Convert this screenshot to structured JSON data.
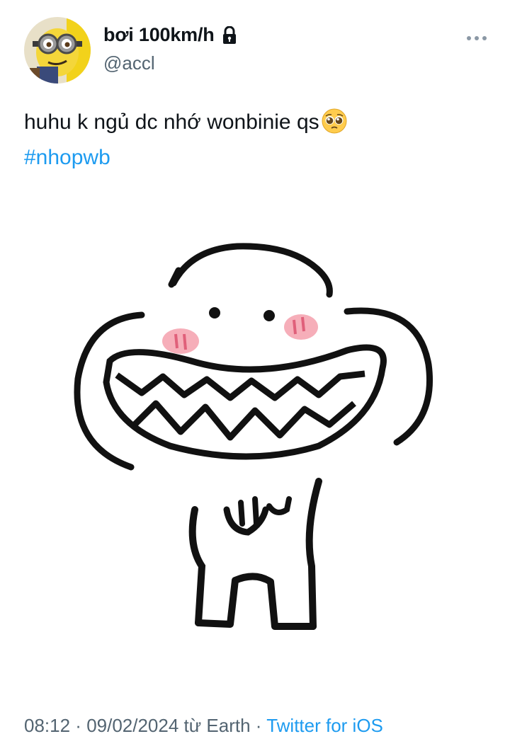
{
  "author": {
    "display_name": "bơi 100km/h",
    "handle": "@accl",
    "avatar_icon": "minion-avatar",
    "locked_icon": "lock-icon"
  },
  "tweet": {
    "text": "huhu k ngủ dc nhớ wonbinie qs",
    "emoji": "pleading-face-emoji",
    "hashtag": "#nhopwb",
    "media_description_icon": "meme-sticker-image"
  },
  "meta": {
    "time": "08:12",
    "separator1": " · ",
    "date": "09/02/2024",
    "from_text": " từ Earth",
    "separator2": " · ",
    "source": "Twitter for iOS"
  },
  "colors": {
    "link": "#1d9bf0",
    "secondary": "#536471",
    "text": "#0f1419"
  }
}
